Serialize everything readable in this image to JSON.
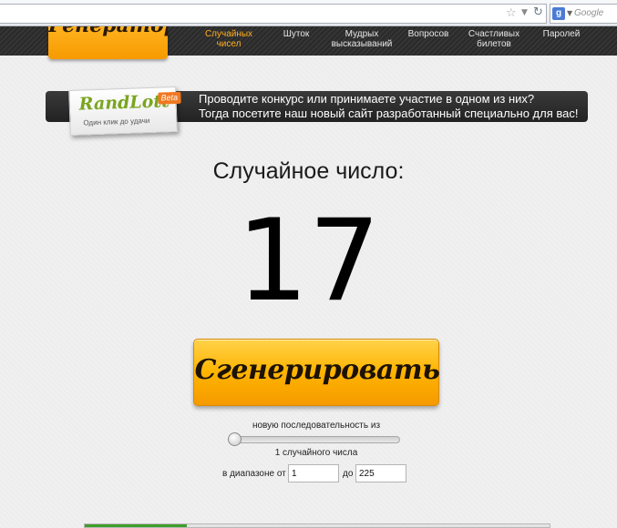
{
  "browser": {
    "search_placeholder": "Google",
    "google_letter": "g"
  },
  "nav": {
    "logo": "Генератор",
    "items": [
      {
        "line1": "Случайных",
        "line2": "чисел",
        "active": true
      },
      {
        "line1": "Шуток",
        "line2": "",
        "active": false
      },
      {
        "line1": "Мудрых",
        "line2": "высказываний",
        "active": false
      },
      {
        "line1": "Вопросов",
        "line2": "",
        "active": false
      },
      {
        "line1": "Счастливых",
        "line2": "билетов",
        "active": false
      },
      {
        "line1": "Паролей",
        "line2": "",
        "active": false
      }
    ]
  },
  "banner": {
    "brand": "RandLott",
    "beta": "Beta",
    "slogan": "Один клик до удачи",
    "line1": "Проводите конкурс или принимаете участие в одном из них?",
    "line2": "Тогда посетите наш новый сайт разработанный специально для вас!"
  },
  "result": {
    "title": "Случайное число:",
    "number": "17"
  },
  "generate_button": "Сгенерировать",
  "options": {
    "sequence_label": "новую последовательность из",
    "slider_value": 1,
    "count_label": "1 случайного числа",
    "range_from_label": "в диапазоне от",
    "range_from_value": "1",
    "range_to_label": "до",
    "range_to_value": "225"
  },
  "bottom_progress": 0.22,
  "colors": {
    "accent": "#ffb400",
    "nav_active": "#ffb020",
    "brand_green": "#7aa520"
  }
}
